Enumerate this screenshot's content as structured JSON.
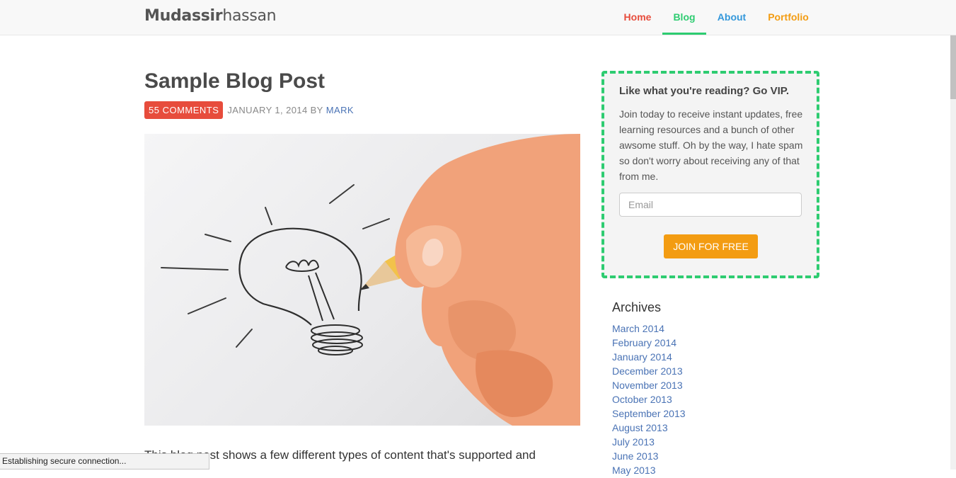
{
  "nav": {
    "brand_bold": "Mudassir",
    "brand_light": "hassan",
    "items": [
      {
        "label": "Home",
        "color": "#e74c3c"
      },
      {
        "label": "Blog",
        "color": "#2ecc71",
        "active": true
      },
      {
        "label": "About",
        "color": "#3498db"
      },
      {
        "label": "Portfolio",
        "color": "#f39c12"
      }
    ]
  },
  "post": {
    "title": "Sample Blog Post",
    "comments_badge": "55 COMMENTS",
    "date_by": "JANUARY 1, 2014 BY",
    "author": "MARK",
    "image_icon": "lightbulb-sketch-illustration",
    "excerpt": "This blog post shows a few different types of content that's supported and"
  },
  "sidebar": {
    "vip": {
      "title": "Like what you're reading? Go VIP.",
      "text": "Join today to receive instant updates, free learning resources and a bunch of other awsome stuff. Oh by the way, I hate spam so don't worry about receiving any of that from me.",
      "email_placeholder": "Email",
      "email_value": "",
      "button_label": "JOIN FOR FREE",
      "border_color": "#2ecc71",
      "button_color": "#f39c12"
    },
    "archives": {
      "title": "Archives",
      "items": [
        "March 2014",
        "February 2014",
        "January 2014",
        "December 2013",
        "November 2013",
        "October 2013",
        "September 2013",
        "August 2013",
        "July 2013",
        "June 2013",
        "May 2013"
      ]
    }
  },
  "status_bar": {
    "text": "Establishing secure connection..."
  }
}
